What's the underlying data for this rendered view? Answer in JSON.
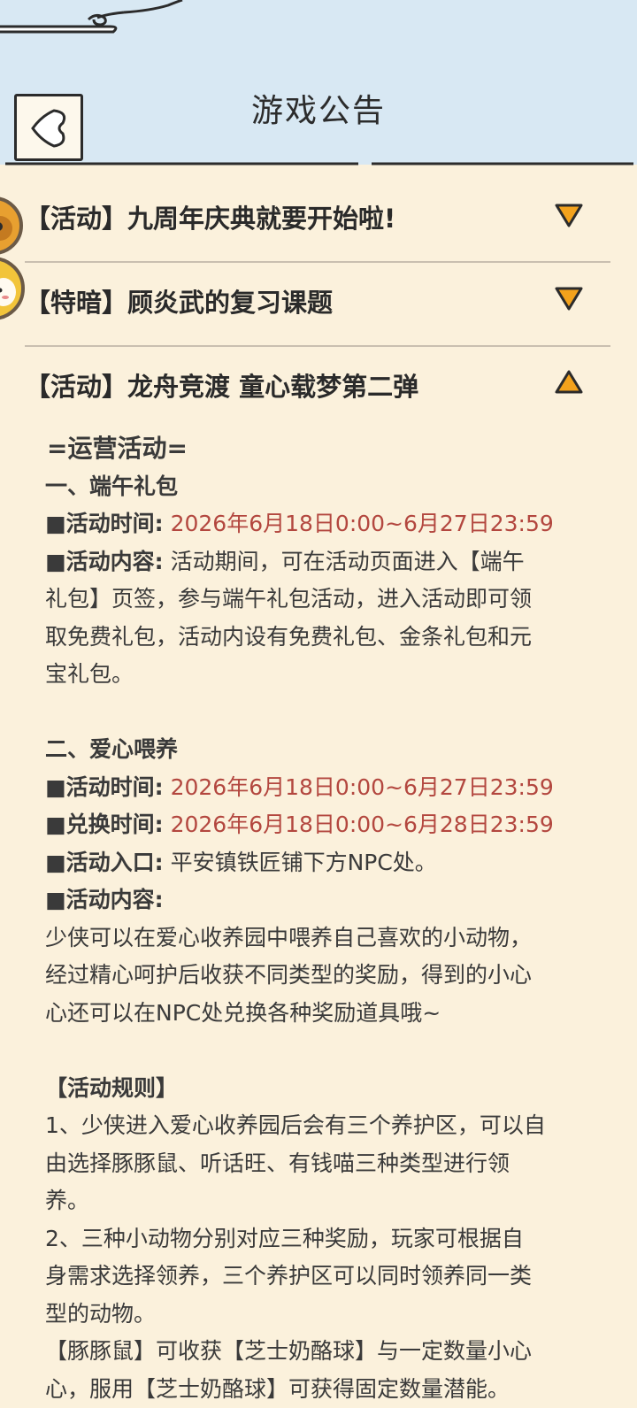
{
  "header": {
    "title": "游戏公告"
  },
  "announcements": [
    {
      "title": "【活动】九周年庆典就要开始啦!",
      "state": "collapsed"
    },
    {
      "title": "【特暗】顾炎武的复习课题",
      "state": "collapsed"
    },
    {
      "title": "【活动】龙舟竞渡 童心载梦第二弹",
      "state": "expanded"
    }
  ],
  "content": {
    "main_heading": "=运营活动=",
    "section1": {
      "heading": "一、端午礼包",
      "time_label": "■活动时间:",
      "time_value": " 2026年6月18日0:00~6月27日23:59",
      "content_label": "■活动内容:",
      "content_lines": [
        " 活动期间，可在活动页面进入【端午",
        "礼包】页签，参与端午礼包活动，进入活动即可领",
        "取免费礼包，活动内设有免费礼包、金条礼包和元",
        "宝礼包。"
      ]
    },
    "section2": {
      "heading": "二、爱心喂养",
      "time_label": "■活动时间:",
      "time_value": " 2026年6月18日0:00~6月27日23:59",
      "exchange_label": "■兑换时间:",
      "exchange_value": " 2026年6月18日0:00~6月28日23:59",
      "entry_label": "■活动入口:",
      "entry_value": " 平安镇铁匠铺下方NPC处。",
      "content_label": "■活动内容:",
      "content_lines": [
        "少侠可以在爱心收养园中喂养自己喜欢的小动物，",
        "经过精心呵护后收获不同类型的奖励，得到的小心",
        "心还可以在NPC处兑换各种奖励道具哦~"
      ]
    },
    "rules": {
      "heading": "【活动规则】",
      "lines": [
        "1、少侠进入爱心收养园后会有三个养护区，可以自",
        "由选择豚豚鼠、听话旺、有钱喵三种类型进行领",
        "养。",
        "2、三种小动物分别对应三种奖励，玩家可根据自",
        "身需求选择领养，三个养护区可以同时领养同一类",
        "型的动物。",
        "【豚豚鼠】可收获【芝士奶酪球】与一定数量小心",
        "心，服用【芝士奶酪球】可获得固定数量潜能。"
      ]
    }
  },
  "colors": {
    "background": "#fbf1dc",
    "header": "#d8e8f3",
    "arrow_fill": "#f3a21c",
    "highlight_red": "#b3473f"
  },
  "icons": {
    "back": "back-arrow-icon",
    "collapsed": "triangle-down-icon",
    "expanded": "triangle-up-icon"
  }
}
